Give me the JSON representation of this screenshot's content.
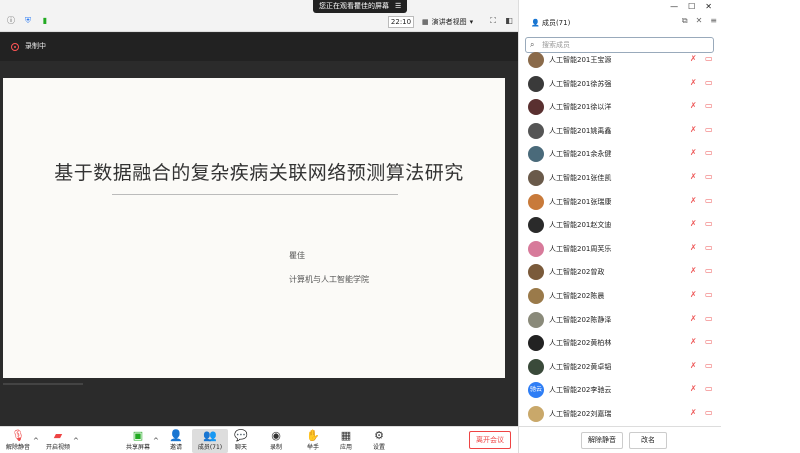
{
  "topbar": {
    "share_banner": "您正在观看瞿佳的屏幕",
    "banner_menu_icon": "menu-icon",
    "timer": "22:10",
    "view_label": "演讲者视图",
    "icons": [
      "info-icon",
      "shield-icon",
      "signal-icon"
    ]
  },
  "recording": {
    "label": "录制中"
  },
  "slide": {
    "title": "基于数据融合的复杂疾病关联网络预测算法研究",
    "author": "瞿佳",
    "institution": "计算机与人工智能学院"
  },
  "toolbar": {
    "unmute": "解除静音",
    "start_video": "开启视频",
    "share_screen": "共享屏幕",
    "invite": "邀请",
    "participants": "成员(71)",
    "chat": "聊天",
    "record": "录制",
    "raise_hand": "举手",
    "apps": "应用",
    "settings": "设置",
    "leave": "离开会议"
  },
  "panel": {
    "title": "成员(71)",
    "search_placeholder": "搜索成员",
    "members": [
      {
        "name": "人工智能201王宝源",
        "avatar_color": "#8a6a4a",
        "avatar_text": ""
      },
      {
        "name": "人工智能201徐苏强",
        "avatar_color": "#3a3a3a",
        "avatar_text": ""
      },
      {
        "name": "人工智能201徐以洋",
        "avatar_color": "#5a3030",
        "avatar_text": ""
      },
      {
        "name": "人工智能201姚禹鑫",
        "avatar_color": "#555555",
        "avatar_text": ""
      },
      {
        "name": "人工智能201余永健",
        "avatar_color": "#4a6a7a",
        "avatar_text": ""
      },
      {
        "name": "人工智能201张佳凯",
        "avatar_color": "#6a5a4a",
        "avatar_text": ""
      },
      {
        "name": "人工智能201张瑞康",
        "avatar_color": "#c87a3a",
        "avatar_text": ""
      },
      {
        "name": "人工智能201赵文迪",
        "avatar_color": "#2a2a2a",
        "avatar_text": ""
      },
      {
        "name": "人工智能201周芙乐",
        "avatar_color": "#d77a9a",
        "avatar_text": ""
      },
      {
        "name": "人工智能202曾政",
        "avatar_color": "#7a5a3a",
        "avatar_text": ""
      },
      {
        "name": "人工智能202陈晨",
        "avatar_color": "#9a7a4a",
        "avatar_text": ""
      },
      {
        "name": "人工智能202陈静泽",
        "avatar_color": "#8a8a7a",
        "avatar_text": ""
      },
      {
        "name": "人工智能202黄柏林",
        "avatar_color": "#222222",
        "avatar_text": ""
      },
      {
        "name": "人工智能202黄卓韬",
        "avatar_color": "#3a4a3a",
        "avatar_text": ""
      },
      {
        "name": "人工智能202李驰云",
        "avatar_color": "#2f7ef5",
        "avatar_text": "驰云"
      },
      {
        "name": "人工智能202刘嘉瑞",
        "avatar_color": "#c9a86a",
        "avatar_text": ""
      }
    ],
    "unmute_all": "解除静音",
    "rename": "改名"
  }
}
